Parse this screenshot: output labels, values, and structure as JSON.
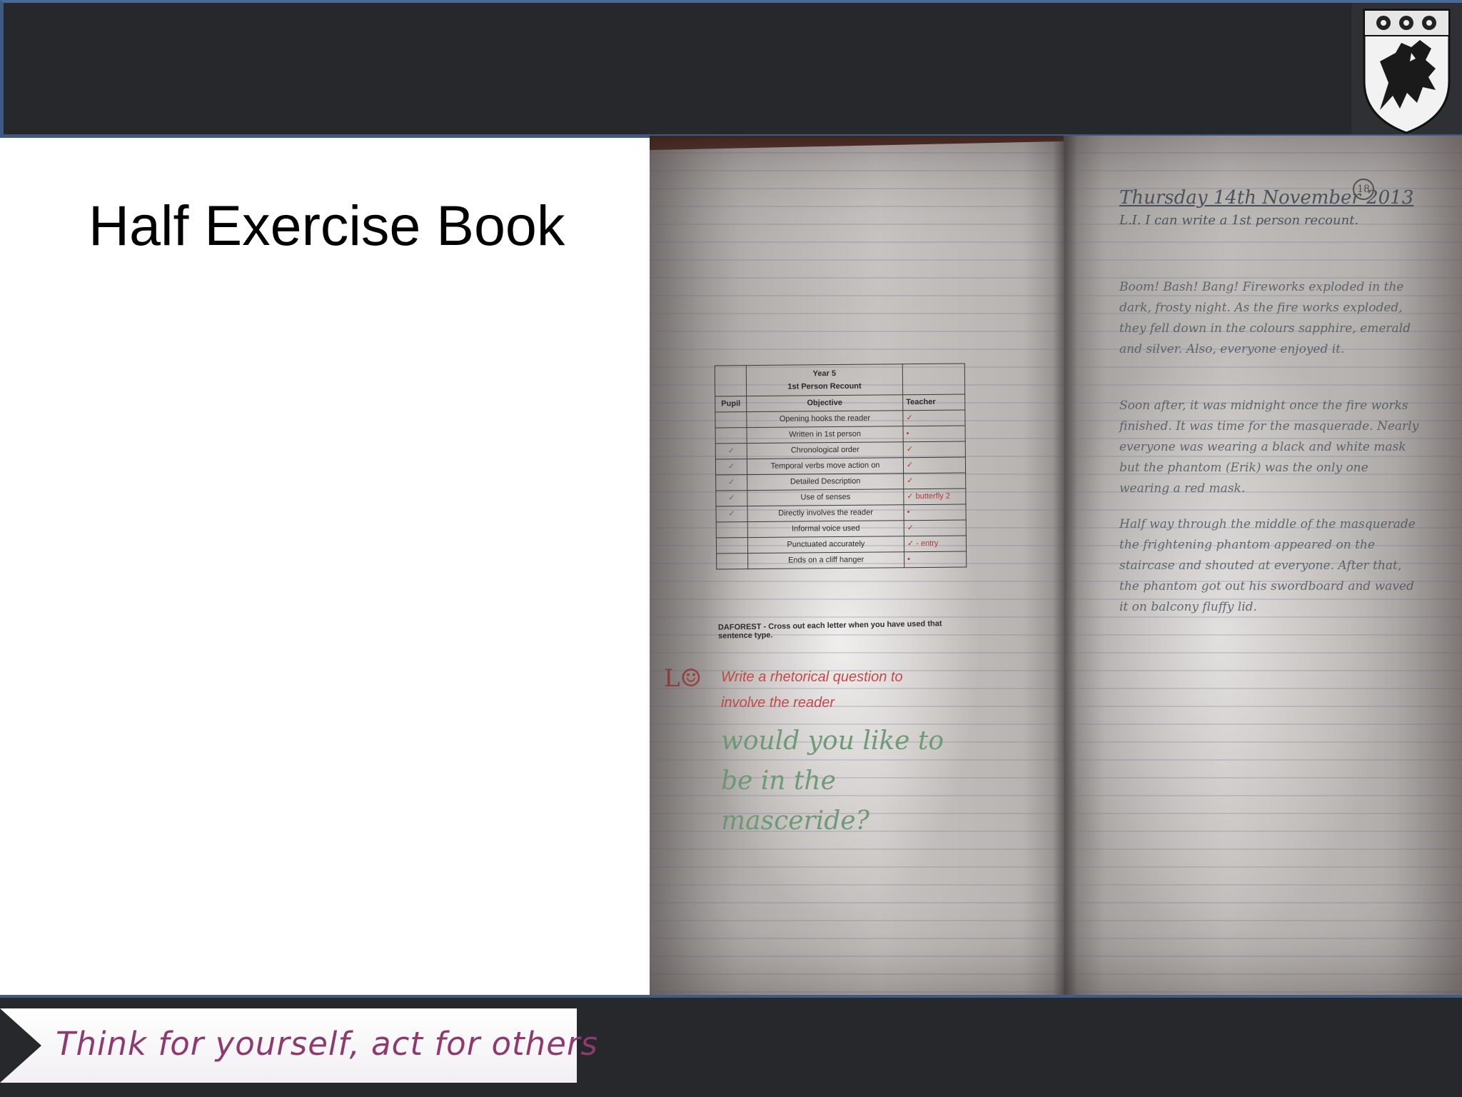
{
  "slide": {
    "title": "Half Exercise Book",
    "motto": "Think for yourself, act for others"
  },
  "exercise_book": {
    "left_page": {
      "rubric": {
        "heading_line1": "Year 5",
        "heading_line2": "1st Person Recount",
        "columns": [
          "Pupil",
          "Objective",
          "Teacher"
        ],
        "rows": [
          {
            "pupil": "",
            "objective": "Opening hooks the reader",
            "teacher": "✓"
          },
          {
            "pupil": "",
            "objective": "Written in 1st person",
            "teacher": "•"
          },
          {
            "pupil": "✓",
            "objective": "Chronological order",
            "teacher": "✓"
          },
          {
            "pupil": "✓",
            "objective": "Temporal verbs move action on",
            "teacher": "✓"
          },
          {
            "pupil": "✓",
            "objective": "Detailed Description",
            "teacher": "✓"
          },
          {
            "pupil": "✓",
            "objective": "Use of senses",
            "teacher": "✓ butterfly 2"
          },
          {
            "pupil": "✓",
            "objective": "Directly involves the reader",
            "teacher": "•"
          },
          {
            "pupil": "",
            "objective": "Informal voice used",
            "teacher": "✓"
          },
          {
            "pupil": "",
            "objective": "Punctuated accurately",
            "teacher": "✓ - entry"
          },
          {
            "pupil": "",
            "objective": "Ends on a cliff hanger",
            "teacher": "•"
          }
        ]
      },
      "instruction": "DAFOREST - Cross out each letter when you have used that sentence type.",
      "lo_mark": "L☺",
      "teacher_note": "Write a rhetorical question to involve the reader",
      "pupil_response": "would you like to be in the masceride?"
    },
    "right_page": {
      "date": "Thursday 14th November 2013",
      "learning_objective": "L.I. I can write a 1st person recount.",
      "page_number": "18",
      "paragraphs": [
        "Boom! Bash! Bang! Fireworks exploded in the dark, frosty night. As the fire works exploded, they fell down in the colours sapphire, emerald and silver. Also, everyone enjoyed it.",
        "Soon after, it was midnight once the fire works finished. It was time for the masquerade. Nearly everyone was wearing a black and white mask but the phantom (Erik) was the only one wearing a red mask.",
        "Half way through the middle of the masquerade the frightening phantom appeared on the staircase and shouted at everyone. After that, the phantom got out his swordboard and waved it on balcony fluffy lid."
      ]
    }
  },
  "colors": {
    "bar": "#26282c",
    "accent_blue": "#3f5c84",
    "motto": "#8e3a6f"
  },
  "icons": [
    "school-crest-icon"
  ]
}
